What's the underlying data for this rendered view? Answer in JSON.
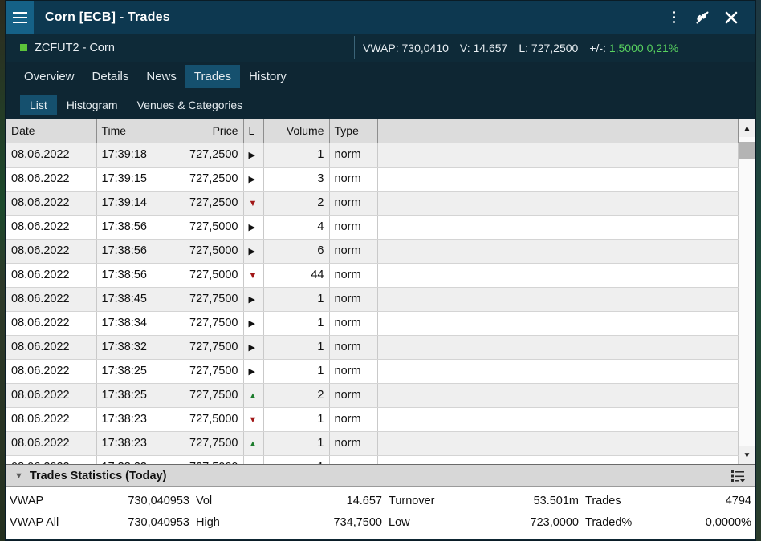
{
  "titlebar": {
    "title": "Corn [ECB] - Trades",
    "menu_icon": "hamburger-icon",
    "more_label": "⋮",
    "unlink_label": "⍁",
    "close_label": "✕"
  },
  "instrument": {
    "symbol": "ZCFUT2 - Corn",
    "status_color": "#5cc43a",
    "vwap_label": "VWAP:",
    "vwap_value": "730,0410",
    "v_label": "V:",
    "v_value": "14.657",
    "l_label": "L:",
    "l_value": "727,2500",
    "change_label": "+/-:",
    "change_value": "1,5000",
    "change_pct": "0,21%",
    "positive_color": "#58d25f"
  },
  "tabs": [
    {
      "label": "Overview",
      "active": false
    },
    {
      "label": "Details",
      "active": false
    },
    {
      "label": "News",
      "active": false
    },
    {
      "label": "Trades",
      "active": true
    },
    {
      "label": "History",
      "active": false
    }
  ],
  "subtabs": [
    {
      "label": "List",
      "active": true
    },
    {
      "label": "Histogram",
      "active": false
    },
    {
      "label": "Venues & Categories",
      "active": false
    }
  ],
  "table": {
    "columns": [
      "Date",
      "Time",
      "Price",
      "L",
      "Volume",
      "Type"
    ],
    "rows": [
      {
        "date": "08.06.2022",
        "time": "17:39:18",
        "price": "727,2500",
        "dir": "flat",
        "volume": "1",
        "type": "norm"
      },
      {
        "date": "08.06.2022",
        "time": "17:39:15",
        "price": "727,2500",
        "dir": "flat",
        "volume": "3",
        "type": "norm"
      },
      {
        "date": "08.06.2022",
        "time": "17:39:14",
        "price": "727,2500",
        "dir": "down",
        "volume": "2",
        "type": "norm"
      },
      {
        "date": "08.06.2022",
        "time": "17:38:56",
        "price": "727,5000",
        "dir": "flat",
        "volume": "4",
        "type": "norm"
      },
      {
        "date": "08.06.2022",
        "time": "17:38:56",
        "price": "727,5000",
        "dir": "flat",
        "volume": "6",
        "type": "norm"
      },
      {
        "date": "08.06.2022",
        "time": "17:38:56",
        "price": "727,5000",
        "dir": "down",
        "volume": "44",
        "type": "norm"
      },
      {
        "date": "08.06.2022",
        "time": "17:38:45",
        "price": "727,7500",
        "dir": "flat",
        "volume": "1",
        "type": "norm"
      },
      {
        "date": "08.06.2022",
        "time": "17:38:34",
        "price": "727,7500",
        "dir": "flat",
        "volume": "1",
        "type": "norm"
      },
      {
        "date": "08.06.2022",
        "time": "17:38:32",
        "price": "727,7500",
        "dir": "flat",
        "volume": "1",
        "type": "norm"
      },
      {
        "date": "08.06.2022",
        "time": "17:38:25",
        "price": "727,7500",
        "dir": "flat",
        "volume": "1",
        "type": "norm"
      },
      {
        "date": "08.06.2022",
        "time": "17:38:25",
        "price": "727,7500",
        "dir": "up",
        "volume": "2",
        "type": "norm"
      },
      {
        "date": "08.06.2022",
        "time": "17:38:23",
        "price": "727,5000",
        "dir": "down",
        "volume": "1",
        "type": "norm"
      },
      {
        "date": "08.06.2022",
        "time": "17:38:23",
        "price": "727,7500",
        "dir": "up",
        "volume": "1",
        "type": "norm"
      }
    ],
    "dir_glyphs": {
      "up": "▲",
      "down": "▼",
      "flat": "▶"
    },
    "price_color": "#1c7c2c",
    "down_color": "#a11717"
  },
  "scrollbar": {
    "up_glyph": "▲",
    "down_glyph": "▼"
  },
  "statistics": {
    "title": "Trades Statistics (Today)",
    "collapse_glyph": "▼",
    "menu_icon": "list-settings-icon",
    "rows": [
      [
        {
          "label": "VWAP",
          "value": "730,040953"
        },
        {
          "label": "Vol",
          "value": "14.657"
        },
        {
          "label": "Turnover",
          "value": "53.501m"
        },
        {
          "label": "Trades",
          "value": "4794"
        }
      ],
      [
        {
          "label": "VWAP All",
          "value": "730,040953"
        },
        {
          "label": "High",
          "value": "734,7500"
        },
        {
          "label": "Low",
          "value": "723,0000"
        },
        {
          "label": "Traded%",
          "value": "0,0000%"
        }
      ]
    ]
  }
}
